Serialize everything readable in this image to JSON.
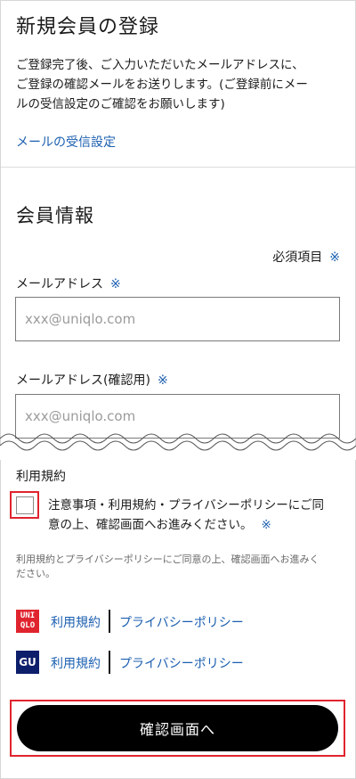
{
  "header": {
    "title": "新規会員の登録",
    "description_1": "ご登録完了後、ご入力いただいたメールアドレスに、",
    "description_2": "ご登録の確認メールをお送りします。(ご登録前にメー",
    "description_3": "ルの受信設定のご確認をお願いします)",
    "mail_settings_link": "メールの受信設定"
  },
  "member_info": {
    "title": "会員情報",
    "required_note": "必須項目",
    "required_mark": "※",
    "email_label": "メールアドレス",
    "email_placeholder": "xxx@uniqlo.com",
    "email_confirm_label": "メールアドレス(確認用)",
    "email_confirm_placeholder": "xxx@uniqlo.com"
  },
  "terms": {
    "title": "利用規約",
    "agree_line_1": "注意事項・利用規約・プライバシーポリシーにご同",
    "agree_line_2": "意の上、確認画面へお進みください。",
    "note_line_1": "利用規約とプライバシーポリシーにご同意の上、確認画面へお進みく",
    "note_line_2": "ださい。",
    "brands": [
      {
        "logo_top": "UNI",
        "logo_bottom": "QLO",
        "terms_link": "利用規約",
        "privacy_link": "プライバシーポリシー",
        "logo_color": "#e0242e"
      },
      {
        "logo_text": "GU",
        "terms_link": "利用規約",
        "privacy_link": "プライバシーポリシー",
        "logo_color": "#0d1e6b"
      }
    ]
  },
  "submit": {
    "label": "確認画面へ"
  },
  "colors": {
    "link": "#1b5fb0",
    "highlight": "#e0242e",
    "button": "#000000"
  }
}
